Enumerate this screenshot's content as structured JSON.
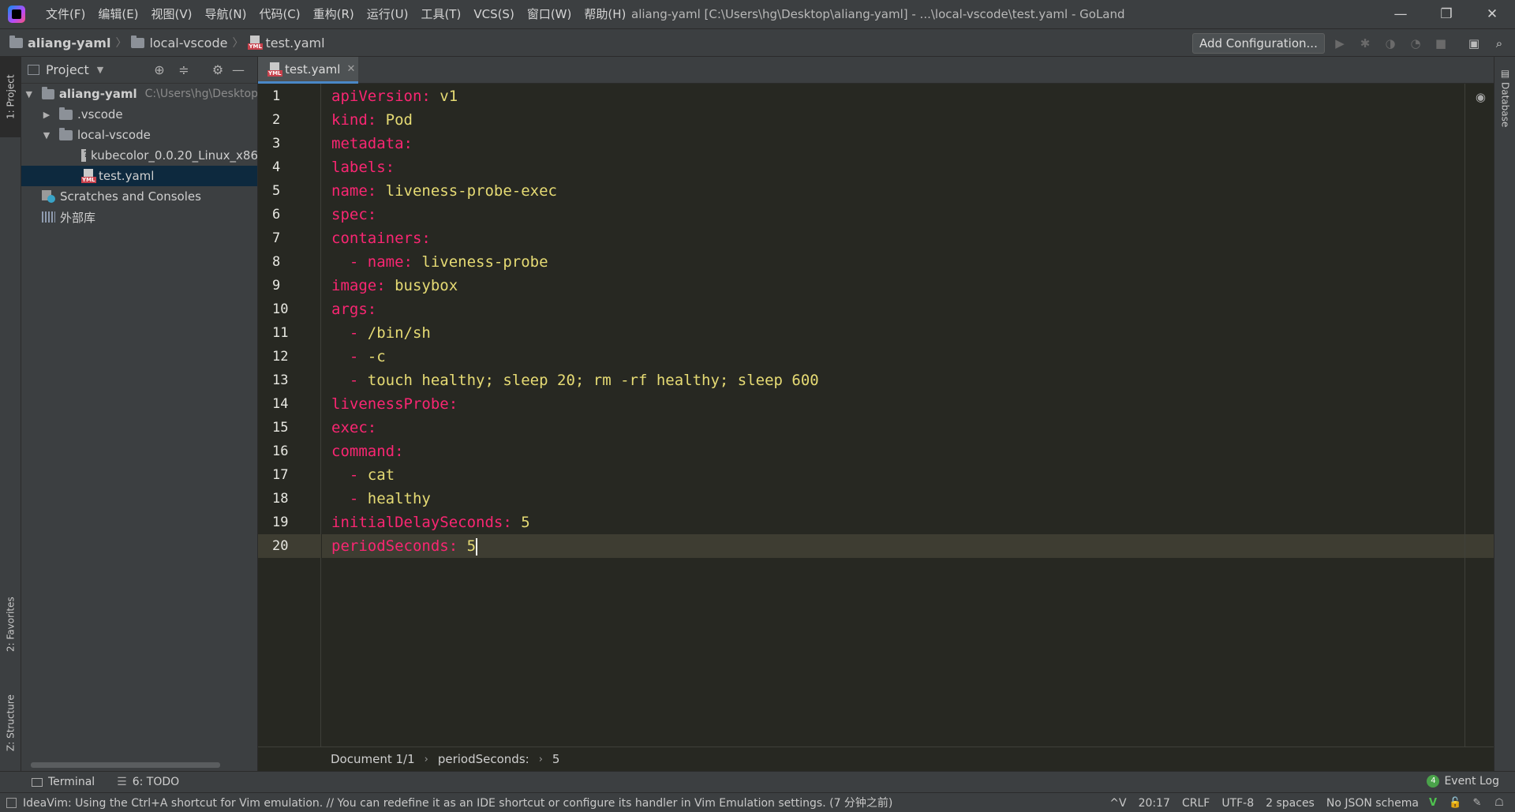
{
  "menu": [
    "文件(F)",
    "编辑(E)",
    "视图(V)",
    "导航(N)",
    "代码(C)",
    "重构(R)",
    "运行(U)",
    "工具(T)",
    "VCS(S)",
    "窗口(W)",
    "帮助(H)"
  ],
  "window_title": "aliang-yaml [C:\\Users\\hg\\Desktop\\aliang-yaml] - ...\\local-vscode\\test.yaml - GoLand",
  "window_controls": {
    "minimize": "—",
    "restore": "❐",
    "close": "✕"
  },
  "navbar": {
    "crumbs": [
      "aliang-yaml",
      "local-vscode",
      "test.yaml"
    ],
    "add_configuration": "Add Configuration..."
  },
  "left_strip": {
    "project": "1: Project",
    "favorites": "2: Favorites",
    "structure": "Z: Structure"
  },
  "right_strip": {
    "database": "Database"
  },
  "project_panel": {
    "title": "Project",
    "tree": {
      "root_name": "aliang-yaml",
      "root_path": "C:\\Users\\hg\\Desktop",
      "vscode": ".vscode",
      "local_vscode": "local-vscode",
      "kubecolor": "kubecolor_0.0.20_Linux_x86",
      "test_yaml": "test.yaml",
      "scratches": "Scratches and Consoles",
      "external_libs": "外部库"
    }
  },
  "editor": {
    "tab_label": "test.yaml",
    "current_line": 20,
    "lines": [
      {
        "n": "1",
        "key": "apiVersion:",
        "val": " v1",
        "indent": ""
      },
      {
        "n": "2",
        "key": "kind:",
        "val": " Pod",
        "indent": ""
      },
      {
        "n": "3",
        "key": "metadata:",
        "val": "",
        "indent": ""
      },
      {
        "n": "4",
        "key": "labels:",
        "val": "",
        "indent": ""
      },
      {
        "n": "5",
        "key": "name:",
        "val": " liveness-probe-exec",
        "indent": ""
      },
      {
        "n": "6",
        "key": "spec:",
        "val": "",
        "indent": ""
      },
      {
        "n": "7",
        "key": "containers:",
        "val": "",
        "indent": ""
      },
      {
        "n": "8",
        "key": "- name:",
        "val": " liveness-probe",
        "indent": "  "
      },
      {
        "n": "9",
        "key": "image:",
        "val": " busybox",
        "indent": ""
      },
      {
        "n": "10",
        "key": "args:",
        "val": "",
        "indent": ""
      },
      {
        "n": "11",
        "key": "-",
        "val": " /bin/sh",
        "indent": "  "
      },
      {
        "n": "12",
        "key": "-",
        "val": " -c",
        "indent": "  "
      },
      {
        "n": "13",
        "key": "-",
        "val": " touch healthy; sleep 20; rm -rf healthy; sleep 600",
        "indent": "  "
      },
      {
        "n": "14",
        "key": "livenessProbe:",
        "val": "",
        "indent": ""
      },
      {
        "n": "15",
        "key": "exec:",
        "val": "",
        "indent": ""
      },
      {
        "n": "16",
        "key": "command:",
        "val": "",
        "indent": ""
      },
      {
        "n": "17",
        "key": "-",
        "val": " cat",
        "indent": "  "
      },
      {
        "n": "18",
        "key": "-",
        "val": " healthy",
        "indent": "  "
      },
      {
        "n": "19",
        "key": "initialDelaySeconds:",
        "val": " 5",
        "indent": ""
      },
      {
        "n": "20",
        "key": "periodSeconds:",
        "val": " 5",
        "indent": ""
      }
    ],
    "breadcrumb": [
      "Document 1/1",
      "periodSeconds:",
      "5"
    ]
  },
  "toolwindows": {
    "terminal": "Terminal",
    "todo": "6: TODO",
    "event_log": "Event Log",
    "event_count": "4"
  },
  "status": {
    "message": "IdeaVim: Using the Ctrl+A shortcut for Vim emulation. // You can redefine it as an IDE shortcut or configure its handler in Vim Emulation settings. (7 分钟之前)",
    "mode": "^V",
    "position": "20:17",
    "line_sep": "CRLF",
    "encoding": "UTF-8",
    "indent": "2 spaces",
    "schema": "No JSON schema"
  },
  "colors": {
    "key": "#f92672",
    "value": "#e6db74",
    "background": "#272822",
    "current_line": "#3e3d32",
    "selection": "#0d293e"
  }
}
